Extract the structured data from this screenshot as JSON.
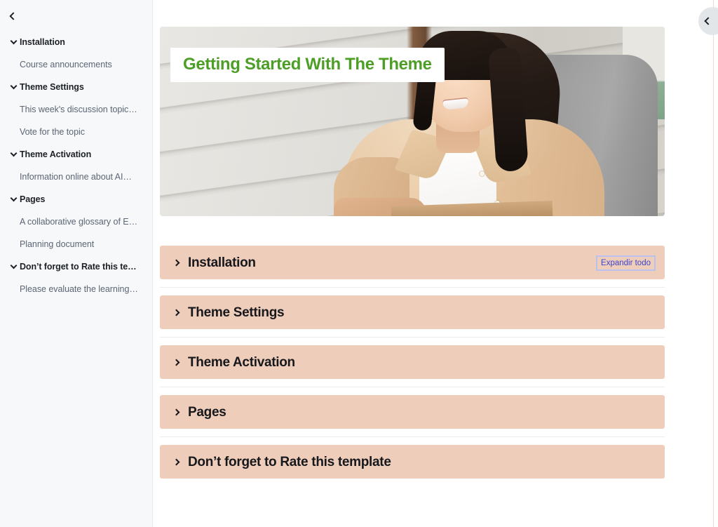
{
  "sidebar": {
    "collapse_icon": "chevron-left-icon",
    "items": [
      {
        "label": "Installation",
        "type": "section",
        "icon": "chevron-down-icon"
      },
      {
        "label": "Course announcements",
        "type": "child"
      },
      {
        "label": "Theme Settings",
        "type": "section",
        "icon": "chevron-down-icon"
      },
      {
        "label": "This week's discussion topic…",
        "type": "child"
      },
      {
        "label": "Vote for the topic",
        "type": "child"
      },
      {
        "label": "Theme Activation",
        "type": "section",
        "icon": "chevron-down-icon"
      },
      {
        "label": "Information online about AI…",
        "type": "child"
      },
      {
        "label": "Pages",
        "type": "section",
        "icon": "chevron-down-icon"
      },
      {
        "label": "A collaborative glossary of E…",
        "type": "child"
      },
      {
        "label": "Planning document",
        "type": "child"
      },
      {
        "label": "Don’t forget to Rate this te…",
        "type": "section",
        "icon": "chevron-down-icon"
      },
      {
        "label": "Please evaluate the learning…",
        "type": "child"
      }
    ]
  },
  "main": {
    "drawer_toggle_icon": "chevron-left-icon",
    "banner": {
      "title": "Getting Started With The Theme",
      "title_color": "#4d9e26",
      "image_alt": "woman-smiling-at-desk-photo"
    },
    "expand_all_label": "Expandir todo",
    "expand_all_color": "#3b45cc",
    "accordion_bg": "#efcdbb",
    "sections": [
      {
        "title": "Installation",
        "icon": "chevron-right-icon",
        "expanded": false
      },
      {
        "title": "Theme Settings",
        "icon": "chevron-right-icon",
        "expanded": false
      },
      {
        "title": "Theme Activation",
        "icon": "chevron-right-icon",
        "expanded": false
      },
      {
        "title": "Pages",
        "icon": "chevron-right-icon",
        "expanded": false
      },
      {
        "title": "Don’t forget to Rate this template",
        "icon": "chevron-right-icon",
        "expanded": false
      }
    ]
  }
}
